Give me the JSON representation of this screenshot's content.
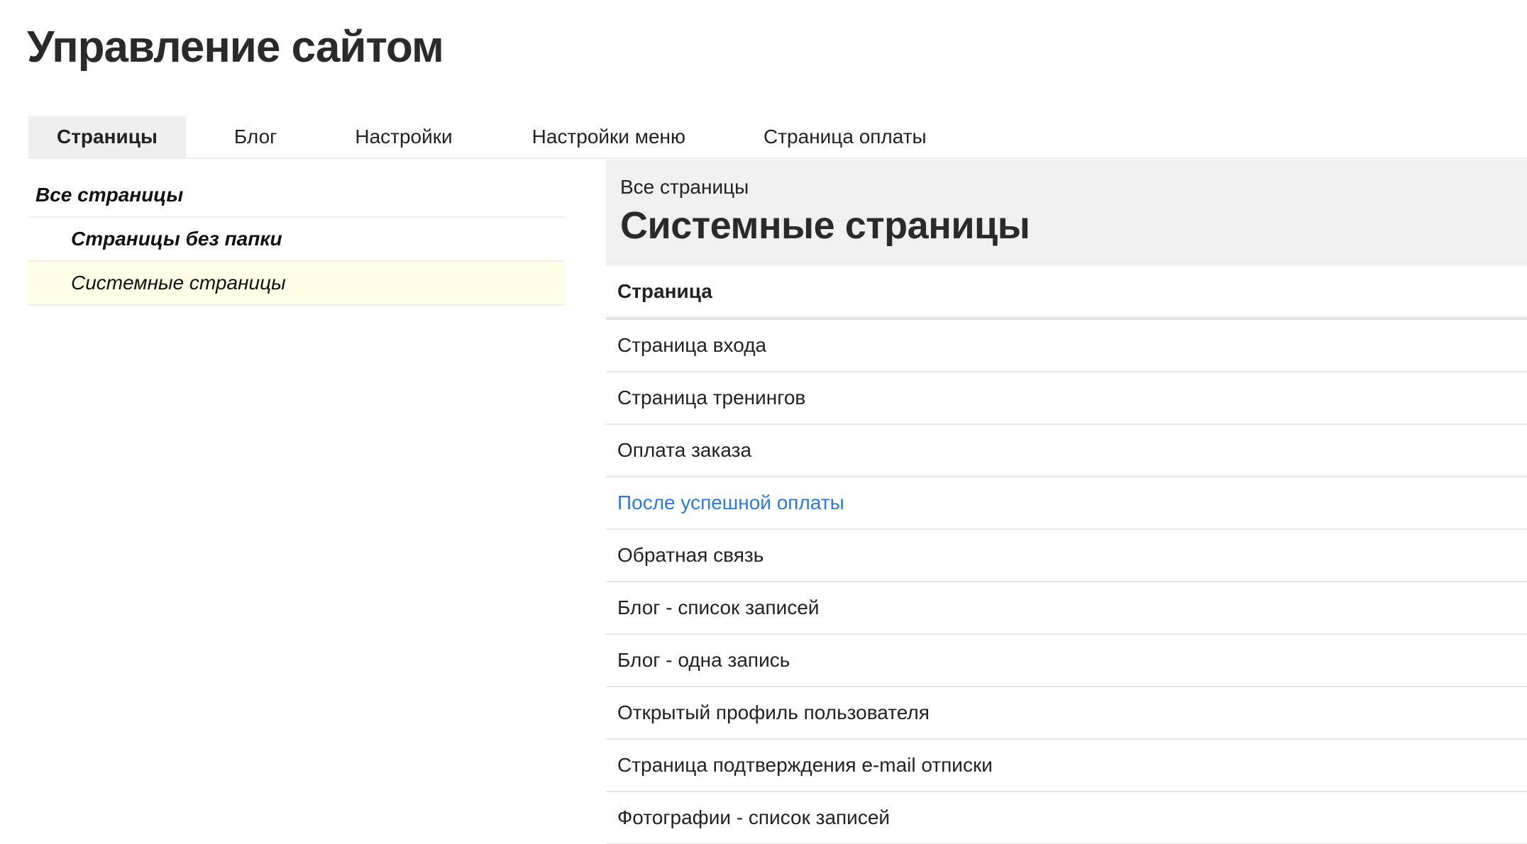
{
  "header": {
    "title": "Управление сайтом"
  },
  "tabs": [
    {
      "label": "Страницы",
      "active": true
    },
    {
      "label": "Блог",
      "active": false
    },
    {
      "label": "Настройки",
      "active": false
    },
    {
      "label": "Настройки меню",
      "active": false
    },
    {
      "label": "Страница оплаты",
      "active": false
    }
  ],
  "sidebar": {
    "items": [
      {
        "label": "Все страницы"
      },
      {
        "label": "Страницы без папки"
      },
      {
        "label": "Системные страницы",
        "selected": true
      }
    ]
  },
  "main": {
    "breadcrumb": "Все страницы",
    "title": "Системные страницы",
    "column_header": "Страница",
    "rows": [
      {
        "label": "Страница входа"
      },
      {
        "label": "Страница тренингов"
      },
      {
        "label": "Оплата заказа"
      },
      {
        "label": "После успешной оплаты",
        "highlighted": true
      },
      {
        "label": "Обратная связь"
      },
      {
        "label": "Блог - список записей"
      },
      {
        "label": "Блог - одна запись"
      },
      {
        "label": "Открытый профиль пользователя"
      },
      {
        "label": "Страница подтверждения e-mail отписки"
      },
      {
        "label": "Фотографии - список записей"
      }
    ]
  },
  "colors": {
    "active_tab_bg": "#eeeeee",
    "selected_tree_bg": "#fefee6",
    "header_bg": "#f0f0f0",
    "link": "#2e7bd6"
  }
}
